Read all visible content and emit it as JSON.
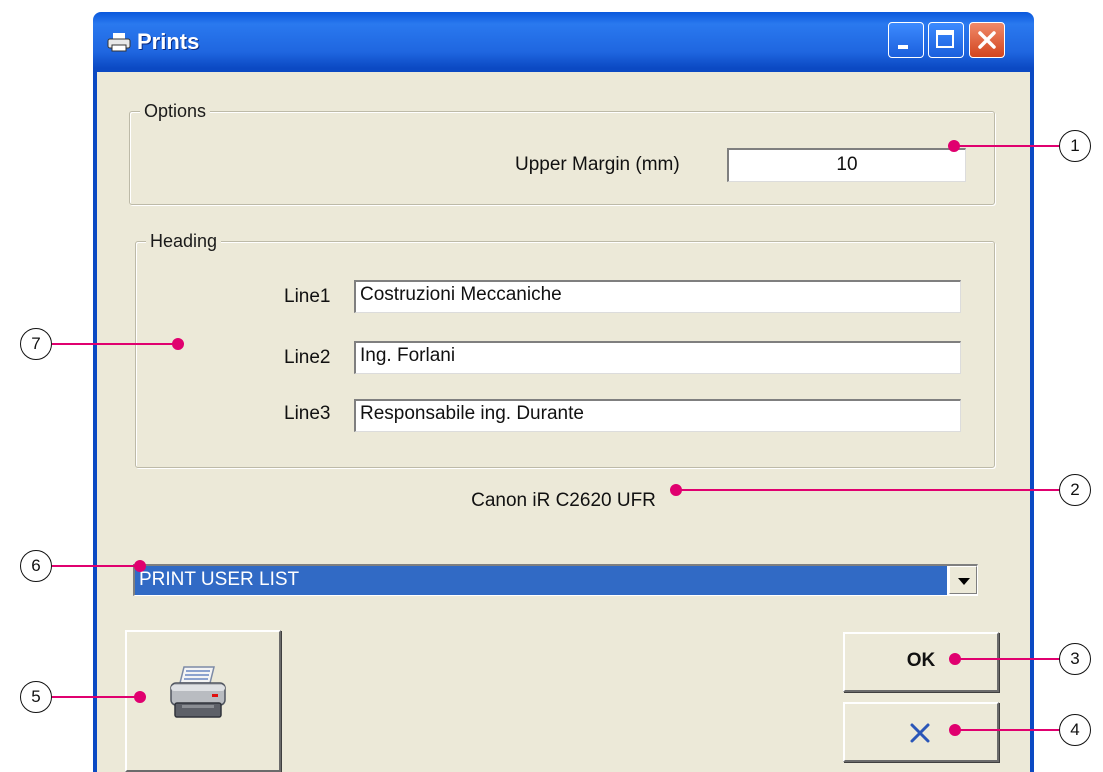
{
  "window": {
    "title": "Prints",
    "controls": [
      "minimize",
      "maximize",
      "close"
    ]
  },
  "options": {
    "legend": "Options",
    "upper_margin_label": "Upper Margin (mm)",
    "upper_margin_value": "10"
  },
  "heading": {
    "legend": "Heading",
    "lines": [
      {
        "label": "Line1",
        "value": "Costruzioni Meccaniche"
      },
      {
        "label": "Line2",
        "value": "Ing. Forlani"
      },
      {
        "label": "Line3",
        "value": "Responsabile ing. Durante"
      }
    ]
  },
  "printer_name": "Canon iR C2620 UFR",
  "report_select": {
    "selected": "PRINT USER LIST"
  },
  "buttons": {
    "ok_label": "OK",
    "cancel_icon": "x-icon",
    "print_icon": "printer-icon"
  },
  "callouts": [
    "1",
    "2",
    "3",
    "4",
    "5",
    "6",
    "7"
  ],
  "colors": {
    "titlebar": "#0a58dc",
    "client": "#ece9d8",
    "selection": "#316ac5",
    "callout_line": "#e0006f"
  }
}
